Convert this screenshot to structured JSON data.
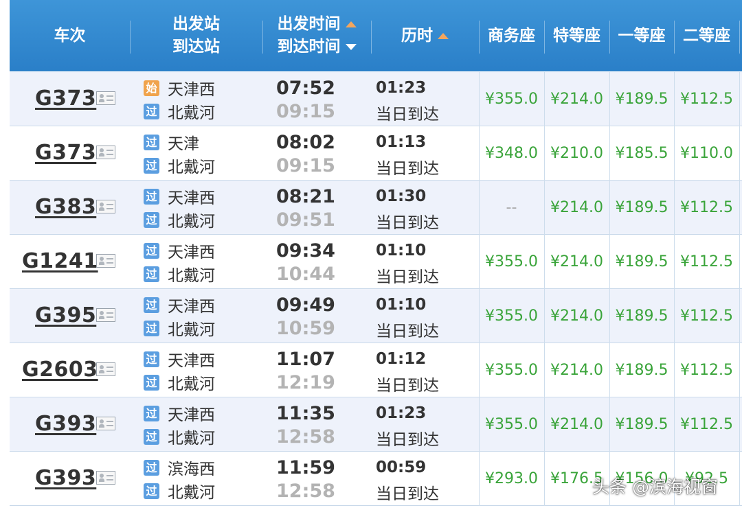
{
  "header": {
    "train_no": "车次",
    "station_dep": "出发站",
    "station_arr": "到达站",
    "time_dep": "出发时间",
    "time_arr": "到达时间",
    "duration": "历时",
    "business": "商务座",
    "premium": "特等座",
    "first": "一等座",
    "second": "二等座"
  },
  "badges": {
    "start": "始",
    "pass": "过"
  },
  "colors": {
    "header_bg": "#2a7fc8",
    "price": "#3aa43a",
    "arrival_time": "#b3b3b3",
    "sort_arrow": "#f2a65e"
  },
  "rows": [
    {
      "train": "G373",
      "dep_station": "天津西",
      "dep_badge": "始",
      "arr_station": "北戴河",
      "arr_badge": "过",
      "dep_time": "07:52",
      "arr_time": "09:15",
      "duration": "01:23",
      "arrival_day": "当日到达",
      "business": "¥355.0",
      "premium": "¥214.0",
      "first": "¥189.5",
      "second": "¥112.5"
    },
    {
      "train": "G373",
      "dep_station": "天津",
      "dep_badge": "过",
      "arr_station": "北戴河",
      "arr_badge": "过",
      "dep_time": "08:02",
      "arr_time": "09:15",
      "duration": "01:13",
      "arrival_day": "当日到达",
      "business": "¥348.0",
      "premium": "¥210.0",
      "first": "¥185.5",
      "second": "¥110.0"
    },
    {
      "train": "G383",
      "dep_station": "天津西",
      "dep_badge": "过",
      "arr_station": "北戴河",
      "arr_badge": "过",
      "dep_time": "08:21",
      "arr_time": "09:51",
      "duration": "01:30",
      "arrival_day": "当日到达",
      "business": "--",
      "premium": "¥214.0",
      "first": "¥189.5",
      "second": "¥112.5"
    },
    {
      "train": "G1241",
      "dep_station": "天津西",
      "dep_badge": "过",
      "arr_station": "北戴河",
      "arr_badge": "过",
      "dep_time": "09:34",
      "arr_time": "10:44",
      "duration": "01:10",
      "arrival_day": "当日到达",
      "business": "¥355.0",
      "premium": "¥214.0",
      "first": "¥189.5",
      "second": "¥112.5"
    },
    {
      "train": "G395",
      "dep_station": "天津西",
      "dep_badge": "过",
      "arr_station": "北戴河",
      "arr_badge": "过",
      "dep_time": "09:49",
      "arr_time": "10:59",
      "duration": "01:10",
      "arrival_day": "当日到达",
      "business": "¥355.0",
      "premium": "¥214.0",
      "first": "¥189.5",
      "second": "¥112.5"
    },
    {
      "train": "G2603",
      "dep_station": "天津西",
      "dep_badge": "过",
      "arr_station": "北戴河",
      "arr_badge": "过",
      "dep_time": "11:07",
      "arr_time": "12:19",
      "duration": "01:12",
      "arrival_day": "当日到达",
      "business": "¥355.0",
      "premium": "¥214.0",
      "first": "¥189.5",
      "second": "¥112.5"
    },
    {
      "train": "G393",
      "dep_station": "天津西",
      "dep_badge": "过",
      "arr_station": "北戴河",
      "arr_badge": "过",
      "dep_time": "11:35",
      "arr_time": "12:58",
      "duration": "01:23",
      "arrival_day": "当日到达",
      "business": "¥355.0",
      "premium": "¥214.0",
      "first": "¥189.5",
      "second": "¥112.5"
    },
    {
      "train": "G393",
      "dep_station": "滨海西",
      "dep_badge": "过",
      "arr_station": "北戴河",
      "arr_badge": "过",
      "dep_time": "11:59",
      "arr_time": "12:58",
      "duration": "00:59",
      "arrival_day": "当日到达",
      "business": "¥293.0",
      "premium": "¥176.5",
      "first": "¥156.0",
      "second": "¥92.5"
    }
  ],
  "watermark": "头条 @滨海视窗"
}
